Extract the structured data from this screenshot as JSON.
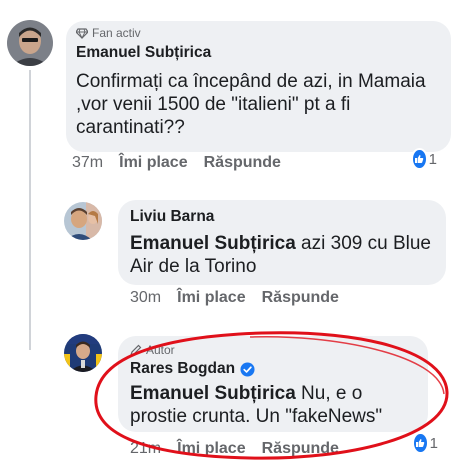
{
  "comment1": {
    "badge": "Fan activ",
    "author": "Emanuel Subțirica",
    "text": "Confirmați ca începând de azi, in Mamaia ,vor venii 1500 de \"italieni\"  pt a fi carantinati??",
    "time": "37m",
    "like_label": "Îmi place",
    "reply_label": "Răspunde",
    "reaction_count": "1"
  },
  "reply1": {
    "author": "Liviu Barna",
    "mention": "Emanuel Subțirica",
    "text": " azi 309 cu Blue Air de la Torino",
    "time": "30m",
    "like_label": "Îmi place",
    "reply_label": "Răspunde"
  },
  "reply2": {
    "badge": "Autor",
    "author": "Rares Bogdan",
    "mention": "Emanuel Subțirica",
    "text": " Nu, e o prostie crunta. Un \"fakeNews\"",
    "time": "21m",
    "like_label": "Îmi place",
    "reply_label": "Răspunde",
    "reaction_count": "1"
  },
  "colors": {
    "bubble": "#eef0f3",
    "like_blue": "#1877f2",
    "verified_blue": "#1877f2",
    "annotation_red": "#e0101a",
    "secondary_text": "#65676b"
  }
}
